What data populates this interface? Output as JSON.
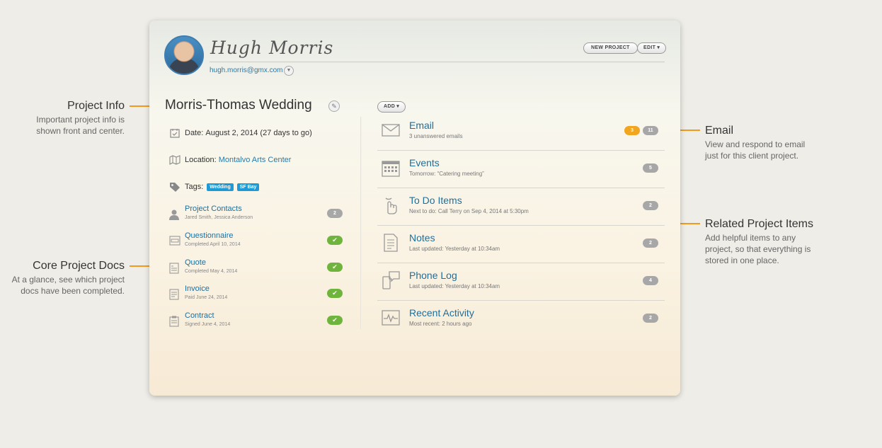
{
  "annotations": {
    "project_info": {
      "title": "Project Info",
      "desc": [
        "Important project info is",
        "shown front and center."
      ]
    },
    "core_docs": {
      "title": "Core Project Docs",
      "desc": [
        "At a glance, see which project",
        "docs have been completed."
      ]
    },
    "email": {
      "title": "Email",
      "desc": [
        "View and respond to email",
        "just for this client project."
      ]
    },
    "related": {
      "title": "Related Project Items",
      "desc": [
        "Add helpful items to any",
        "project, so that everything is",
        "stored in one place."
      ]
    }
  },
  "user": {
    "name": "Hugh Morris",
    "email": "hugh.morris@gmx.com"
  },
  "header": {
    "new_project": "NEW PROJECT",
    "edit": "EDIT ▾"
  },
  "project": {
    "title": "Morris-Thomas Wedding",
    "date_label": "Date:",
    "date_value": "August 2, 2014  (27 days to go)",
    "location_label": "Location:",
    "location_value": "Montalvo Arts Center",
    "tags_label": "Tags:",
    "tags": [
      "Wedding",
      "SF Bay"
    ]
  },
  "docs": [
    {
      "name": "Project Contacts",
      "sub": "Jared Smith, Jessica Anderson",
      "count": "2"
    },
    {
      "name": "Questionnaire",
      "sub": "Completed April 10, 2014",
      "check": "✔"
    },
    {
      "name": "Quote",
      "sub": "Completed May 4, 2014",
      "check": "✔"
    },
    {
      "name": "Invoice",
      "sub": "Paid June 24, 2014",
      "check": "✔"
    },
    {
      "name": "Contract",
      "sub": "Signed June 4, 2014",
      "check": "✔"
    }
  ],
  "add_label": "ADD ▾",
  "items": [
    {
      "name": "Email",
      "sub": "3 unanswered emails",
      "unread": "3",
      "count": "11"
    },
    {
      "name": "Events",
      "sub": "Tomorrow: “Catering meeting”",
      "count": "5"
    },
    {
      "name": "To Do Items",
      "sub": "Next to do: Call Terry on Sep 4, 2014 at 5:30pm",
      "count": "2"
    },
    {
      "name": "Notes",
      "sub": "Last updated: Yesterday at 10:34am",
      "count": "2"
    },
    {
      "name": "Phone Log",
      "sub": "Last updated: Yesterday at 10:34am",
      "count": "4"
    },
    {
      "name": "Recent Activity",
      "sub": "Most recent: 2 hours ago",
      "count": "2"
    }
  ],
  "colors": {
    "accent": "#f39a1e",
    "link": "#1e6f9e",
    "check": "#6fb43c",
    "tag": "#1e9ad6"
  }
}
